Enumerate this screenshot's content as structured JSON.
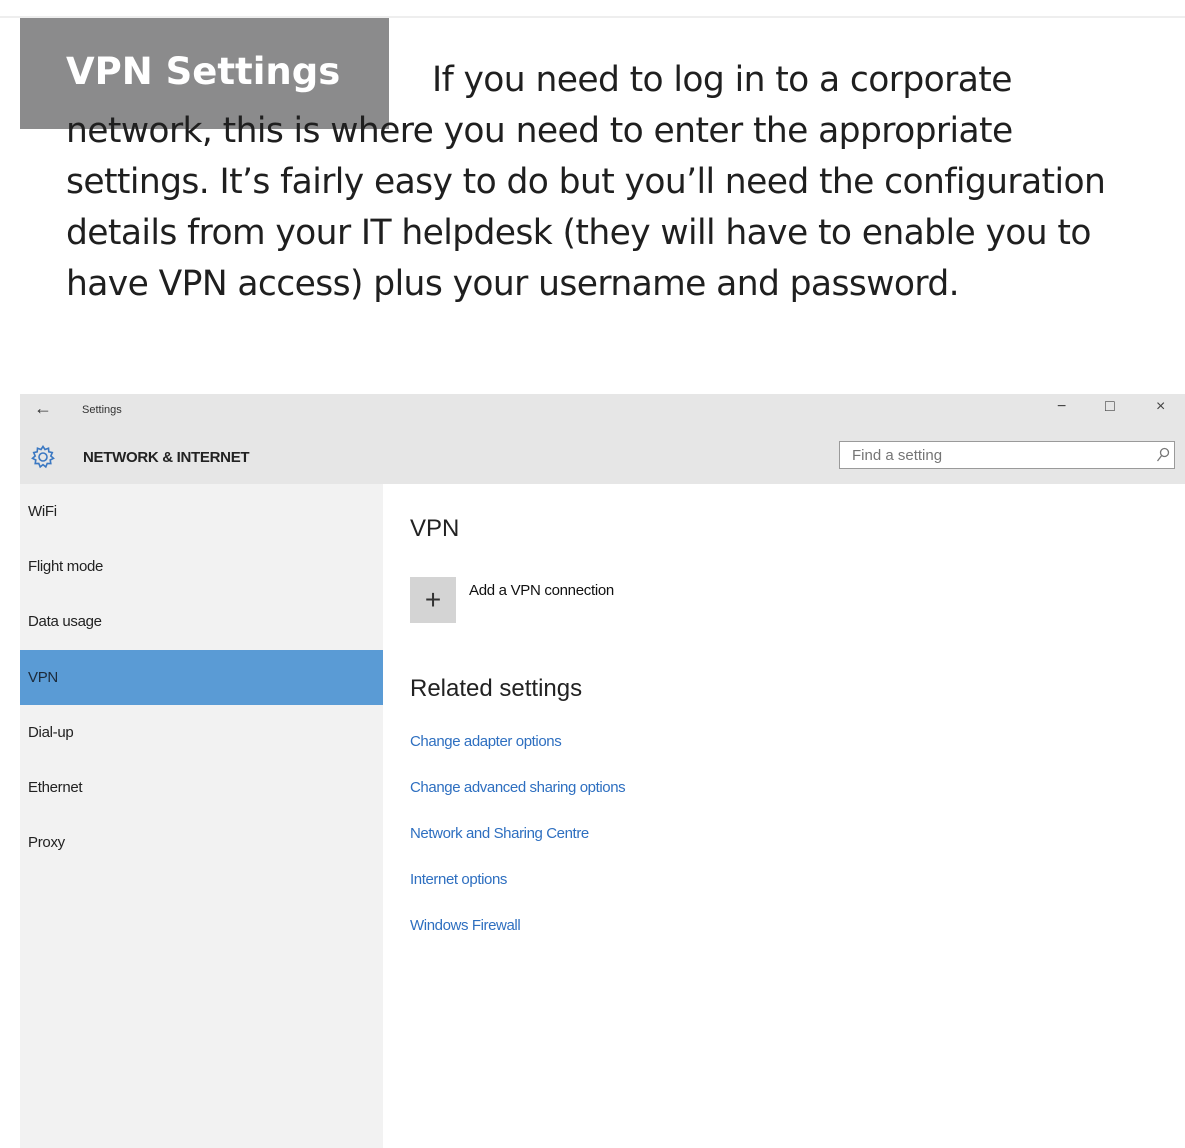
{
  "article": {
    "title": "VPN Settings",
    "intro": "If you need to log in to a corporate network, this is where you need to enter the appropriate settings. It’s fairly easy to do but you’ll need the configuration details from your IT helpdesk (they will have to enable you to have VPN access) plus your username and password."
  },
  "window": {
    "back_glyph": "←",
    "app_name": "Settings",
    "controls": {
      "minimize": "−",
      "maximize": "□",
      "close": "×"
    },
    "section_title": "NETWORK & INTERNET",
    "search": {
      "placeholder": "Find a setting",
      "value": ""
    }
  },
  "sidebar": {
    "items": [
      {
        "label": "WiFi"
      },
      {
        "label": "Flight mode"
      },
      {
        "label": "Data usage"
      },
      {
        "label": "VPN",
        "selected": true
      },
      {
        "label": "Dial-up"
      },
      {
        "label": "Ethernet"
      },
      {
        "label": "Proxy"
      }
    ]
  },
  "content": {
    "heading": "VPN",
    "add_label": "Add a VPN connection",
    "add_glyph": "+",
    "related_heading": "Related settings",
    "related_links": [
      "Change adapter options",
      "Change advanced sharing options",
      "Network and Sharing Centre",
      "Internet options",
      "Windows Firewall"
    ]
  },
  "colors": {
    "accent": "#5a9bd5",
    "link": "#2e6fc0",
    "title_box": "#8b8b8c"
  },
  "icons": {
    "gear": "gear-icon",
    "search": "search-icon",
    "add": "plus-icon",
    "back": "back-arrow-icon"
  }
}
